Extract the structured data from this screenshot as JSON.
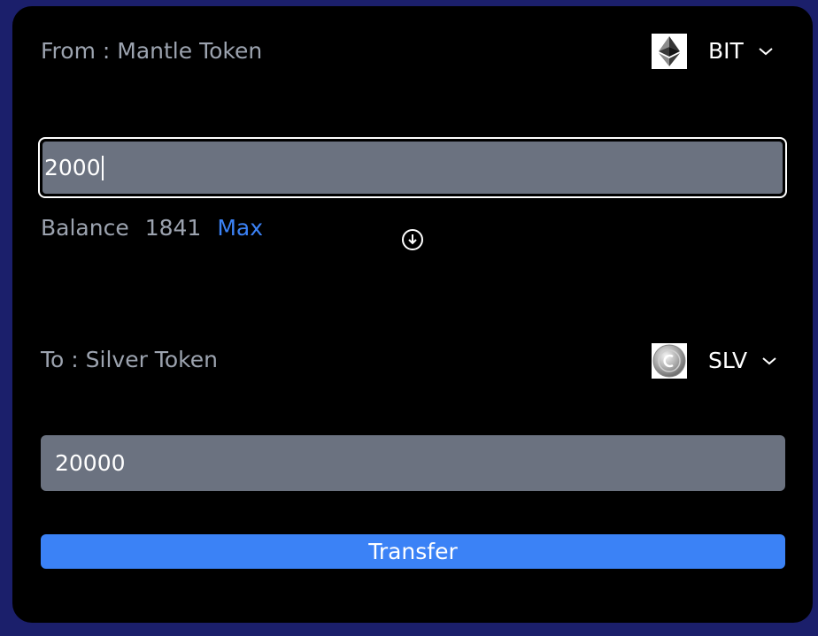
{
  "from": {
    "label": "From : Mantle Token",
    "token_symbol": "BIT",
    "token_icon": "ethereum-diamond-icon",
    "amount_value": "2000"
  },
  "balance": {
    "label": "Balance",
    "value": "1841",
    "max_label": "Max"
  },
  "swap_icon": "arrow-down-circle-icon",
  "to": {
    "label": "To : Silver Token",
    "token_symbol": "SLV",
    "token_icon": "silver-coin-icon",
    "amount_value": "20000"
  },
  "transfer_button": {
    "label": "Transfer"
  },
  "colors": {
    "background": "#1b1f6b",
    "card": "#000000",
    "input_bg": "#6b7280",
    "muted_text": "#9ca3af",
    "accent": "#3b82f6"
  }
}
